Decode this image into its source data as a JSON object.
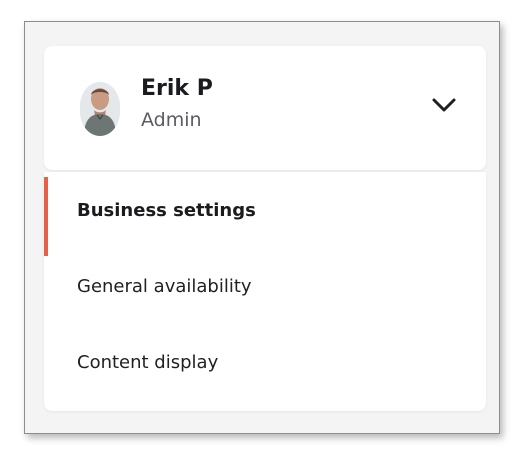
{
  "profile": {
    "name": "Erik P",
    "role": "Admin",
    "avatar_icon": "user-avatar-photo",
    "toggle_icon": "chevron-down-icon"
  },
  "menu": {
    "items": [
      {
        "label": "Business settings",
        "active": true
      },
      {
        "label": "General availability",
        "active": false
      },
      {
        "label": "Content display",
        "active": false
      }
    ],
    "accent_color": "#e2634a"
  }
}
